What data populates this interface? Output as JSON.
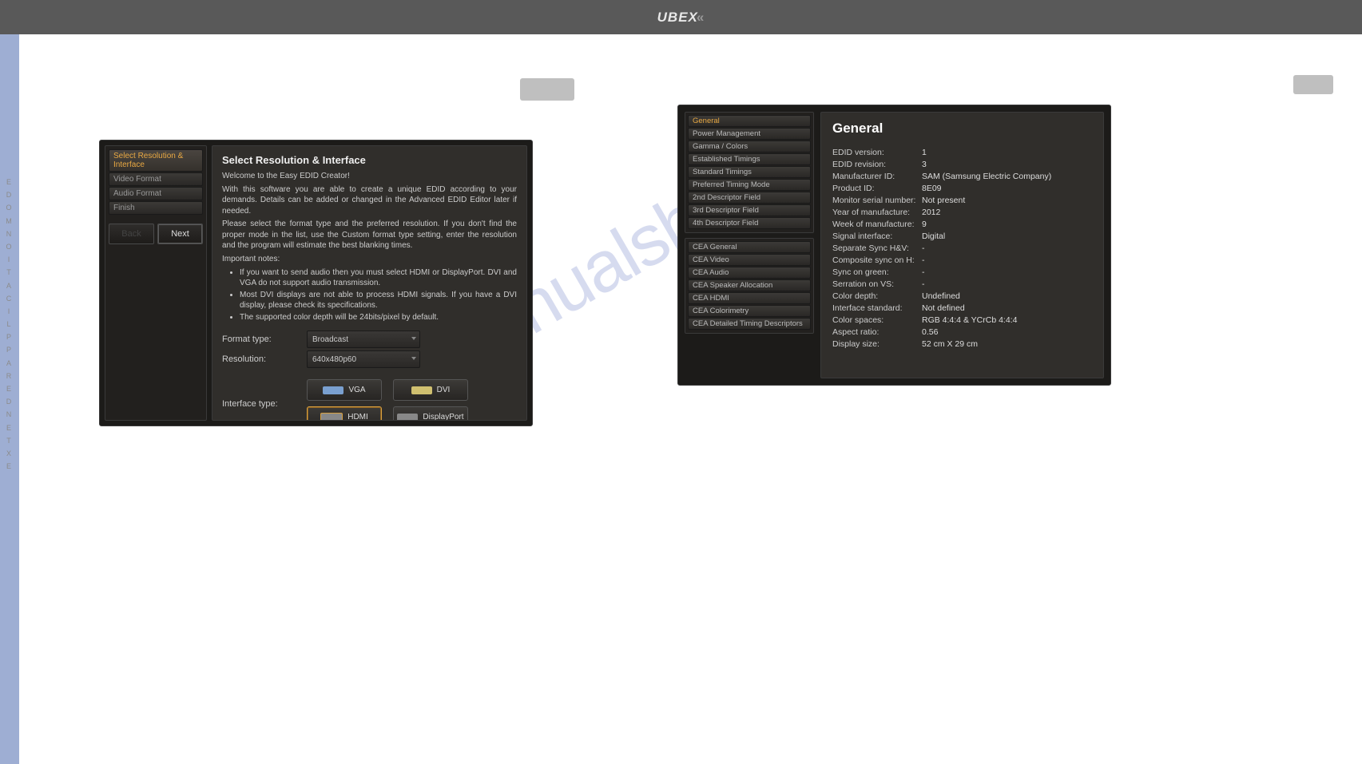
{
  "brand": "UBEX",
  "side_label": "EXTENDER  APPLICATION  MODE",
  "watermark": "manualshive",
  "dialog": {
    "steps": [
      {
        "label": "Select Resolution & Interface",
        "active": true
      },
      {
        "label": "Video Format"
      },
      {
        "label": "Audio Format"
      },
      {
        "label": "Finish"
      }
    ],
    "back_label": "Back",
    "next_label": "Next",
    "title": "Select Resolution & Interface",
    "welcome": "Welcome to the Easy EDID Creator!",
    "desc1": "With this software you are able to create a unique EDID according to your demands. Details can be added or changed in the Advanced EDID Editor later if needed.",
    "desc2": "Please select the format type and the preferred resolution. If you don't find the proper mode in the list, use the Custom format type setting, enter the resolution and the program will estimate the best blanking times.",
    "notes_label": "Important notes:",
    "notes": [
      "If you want to send audio then you must select HDMI or DisplayPort. DVI and VGA do not support audio transmission.",
      "Most DVI displays are not able to process HDMI signals. If you have a DVI display, please check its specifications.",
      "The supported color depth will be 24bits/pixel by default."
    ],
    "format_label": "Format type:",
    "format_value": "Broadcast",
    "resolution_label": "Resolution:",
    "resolution_value": "640x480p60",
    "interface_label": "Interface type:",
    "interfaces": [
      "VGA",
      "DVI",
      "HDMI",
      "DisplayPort"
    ],
    "interface_selected": "HDMI"
  },
  "panel": {
    "nav_blocks": [
      [
        "General",
        "Power Management",
        "Gamma / Colors",
        "Established Timings",
        "Standard Timings",
        "Preferred Timing Mode",
        "2nd Descriptor Field",
        "3rd Descriptor Field",
        "4th Descriptor Field"
      ],
      [
        "CEA General",
        "CEA Video",
        "CEA Audio",
        "CEA Speaker Allocation",
        "CEA HDMI",
        "CEA Colorimetry",
        "CEA Detailed Timing Descriptors"
      ]
    ],
    "nav_active": "General",
    "title": "General",
    "rows": [
      {
        "k": "EDID version:",
        "v": "1"
      },
      {
        "k": "EDID revision:",
        "v": "3"
      },
      {
        "k": "Manufacturer ID:",
        "v": "SAM (Samsung Electric Company)"
      },
      {
        "k": "Product ID:",
        "v": "8E09"
      },
      {
        "k": "Monitor serial number:",
        "v": "Not present"
      },
      {
        "k": "Year of manufacture:",
        "v": "2012"
      },
      {
        "k": "Week of manufacture:",
        "v": "9"
      },
      {
        "k": "Signal interface:",
        "v": "Digital"
      },
      {
        "k": "Separate Sync H&V:",
        "v": "-"
      },
      {
        "k": "Composite sync on H:",
        "v": "-"
      },
      {
        "k": "Sync on green:",
        "v": "-"
      },
      {
        "k": "Serration on VS:",
        "v": "-"
      },
      {
        "k": "Color depth:",
        "v": "Undefined"
      },
      {
        "k": "Interface standard:",
        "v": "Not defined"
      },
      {
        "k": "Color spaces:",
        "v": "RGB 4:4:4 & YCrCb 4:4:4"
      },
      {
        "k": "Aspect ratio:",
        "v": "0.56"
      },
      {
        "k": "Display size:",
        "v": "52 cm X 29 cm"
      }
    ]
  }
}
